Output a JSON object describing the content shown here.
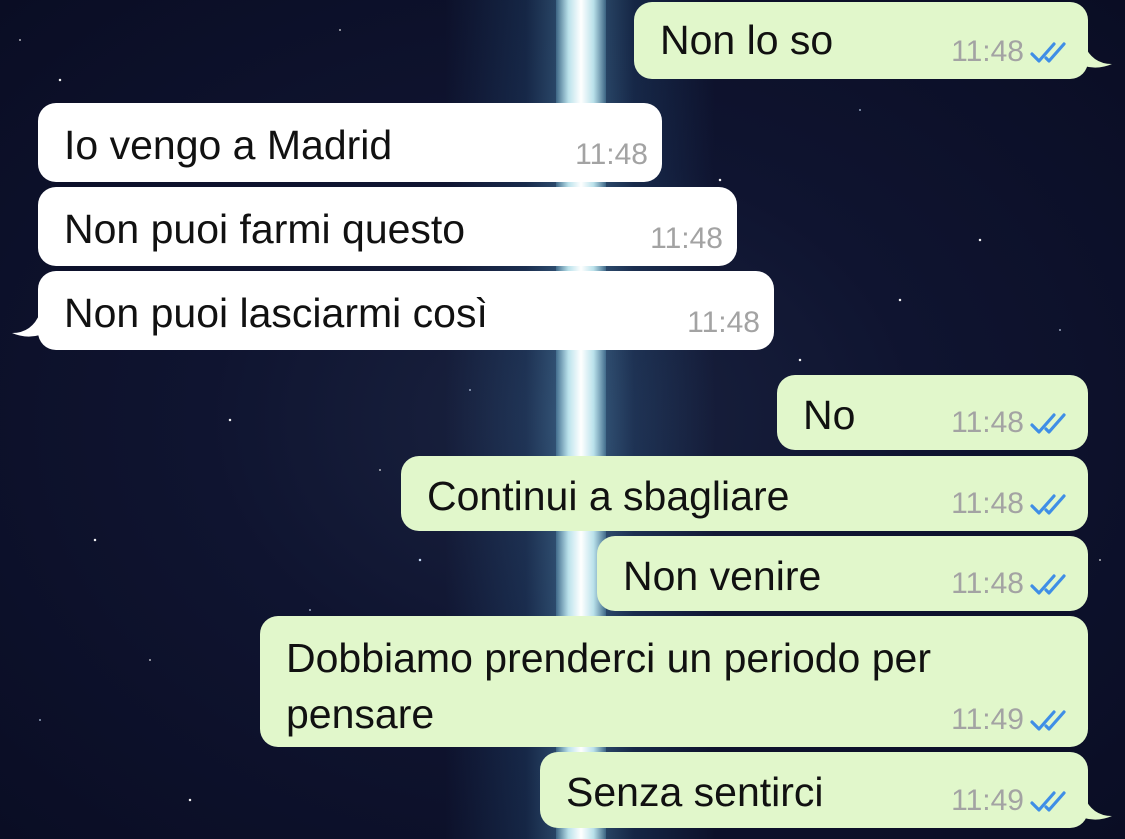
{
  "colors": {
    "incoming_bubble": "#ffffff",
    "outgoing_bubble": "#e1f7cb",
    "timestamp": "#a3a3a3",
    "read_ticks": "#3f8ee6"
  },
  "messages": [
    {
      "direction": "outgoing",
      "text": "Non lo so",
      "time": "11:48",
      "status": "read-double-check-icon"
    },
    {
      "direction": "incoming",
      "text": "Io vengo a Madrid",
      "time": "11:48"
    },
    {
      "direction": "incoming",
      "text": "Non puoi farmi questo",
      "time": "11:48"
    },
    {
      "direction": "incoming",
      "text": "Non puoi lasciarmi così",
      "time": "11:48"
    },
    {
      "direction": "outgoing",
      "text": "No",
      "time": "11:48",
      "status": "read-double-check-icon"
    },
    {
      "direction": "outgoing",
      "text": "Continui a sbagliare",
      "time": "11:48",
      "status": "read-double-check-icon"
    },
    {
      "direction": "outgoing",
      "text": "Non venire",
      "time": "11:48",
      "status": "read-double-check-icon"
    },
    {
      "direction": "outgoing",
      "text": "Dobbiamo prenderci un periodo per pensare",
      "time": "11:49",
      "status": "read-double-check-icon"
    },
    {
      "direction": "outgoing",
      "text": "Senza sentirci",
      "time": "11:49",
      "status": "read-double-check-icon"
    }
  ]
}
